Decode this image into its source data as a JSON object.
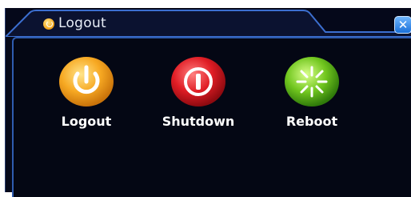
{
  "window": {
    "title": "Logout",
    "close_label": "✕"
  },
  "actions": [
    {
      "label": "Logout",
      "icon": "power-icon",
      "color": "#f4a21c"
    },
    {
      "label": "Shutdown",
      "icon": "power-off-icon",
      "color": "#d81c24"
    },
    {
      "label": "Reboot",
      "icon": "restart-burst-icon",
      "color": "#6cc21c"
    }
  ]
}
